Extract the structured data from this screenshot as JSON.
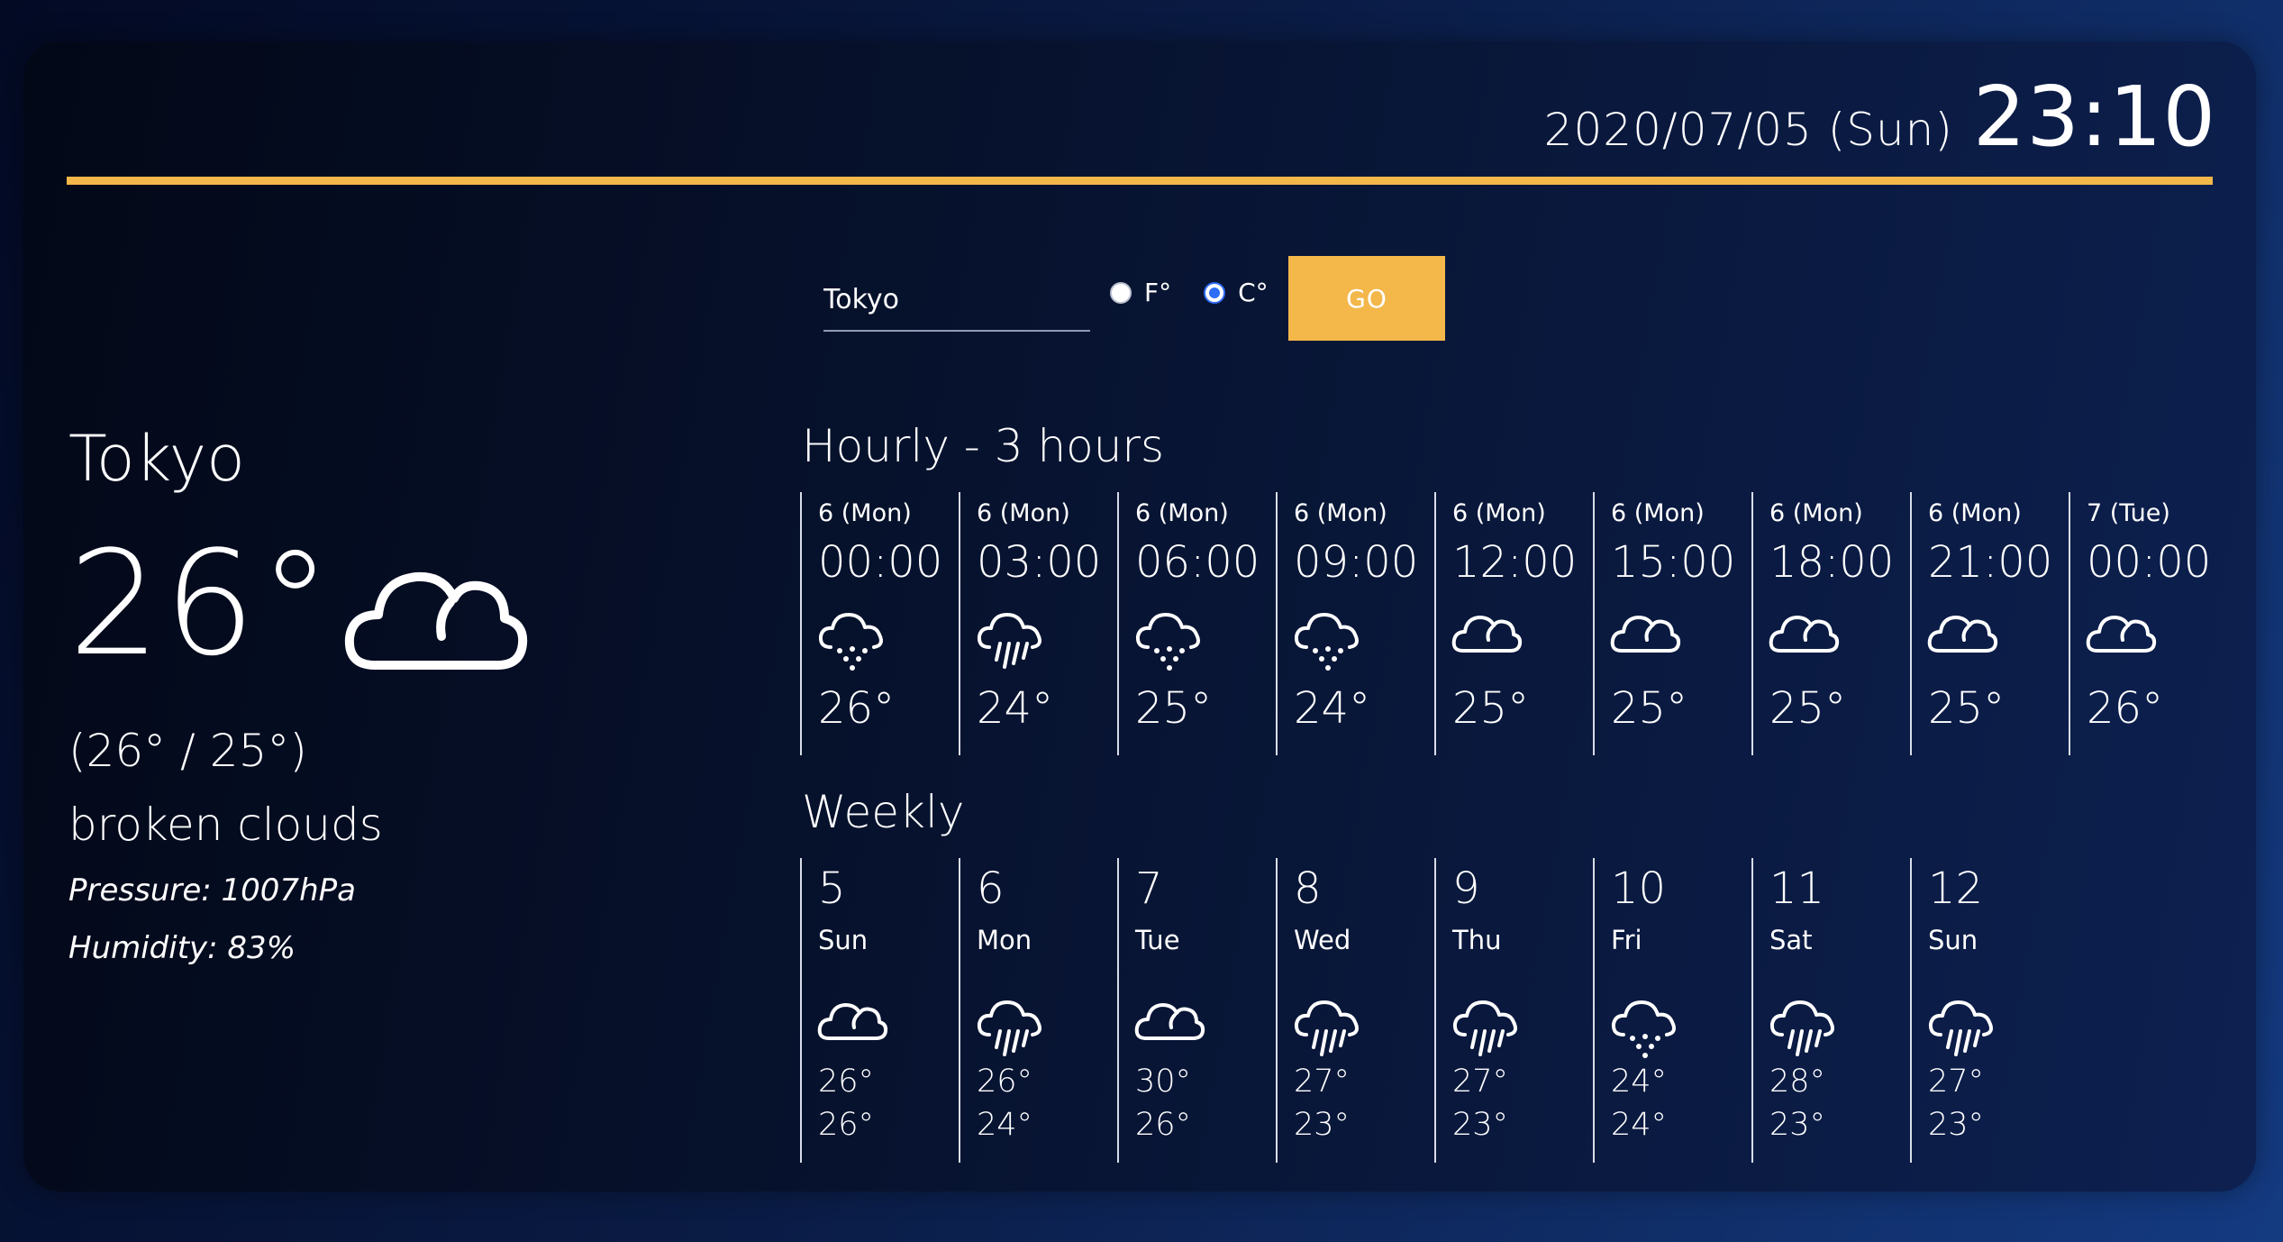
{
  "colors": {
    "accent": "#f3b74a",
    "radio_selected": "#2f6df6"
  },
  "header": {
    "date": "2020/07/05 (Sun)",
    "time": "23:10"
  },
  "search": {
    "city_value": "Tokyo",
    "unit_f_label": "F°",
    "unit_c_label": "C°",
    "selected_unit": "C",
    "go_label": "GO"
  },
  "current": {
    "city": "Tokyo",
    "temp": "26°",
    "icon": "broken-clouds-icon",
    "minmax": "(26° / 25°)",
    "description": "broken clouds",
    "pressure": "Pressure: 1007hPa",
    "humidity": "Humidity: 83%"
  },
  "hourly": {
    "title": "Hourly - 3 hours",
    "items": [
      {
        "day": "6 (Mon)",
        "hour": "00:00",
        "temp": "26°",
        "icon": "drizzle-icon"
      },
      {
        "day": "6 (Mon)",
        "hour": "03:00",
        "temp": "24°",
        "icon": "rain-icon"
      },
      {
        "day": "6 (Mon)",
        "hour": "06:00",
        "temp": "25°",
        "icon": "drizzle-icon"
      },
      {
        "day": "6 (Mon)",
        "hour": "09:00",
        "temp": "24°",
        "icon": "drizzle-icon"
      },
      {
        "day": "6 (Mon)",
        "hour": "12:00",
        "temp": "25°",
        "icon": "cloud-icon"
      },
      {
        "day": "6 (Mon)",
        "hour": "15:00",
        "temp": "25°",
        "icon": "cloud-icon"
      },
      {
        "day": "6 (Mon)",
        "hour": "18:00",
        "temp": "25°",
        "icon": "cloud-icon"
      },
      {
        "day": "6 (Mon)",
        "hour": "21:00",
        "temp": "25°",
        "icon": "cloud-icon"
      },
      {
        "day": "7 (Tue)",
        "hour": "00:00",
        "temp": "26°",
        "icon": "cloud-icon"
      }
    ]
  },
  "weekly": {
    "title": "Weekly",
    "items": [
      {
        "date": "5",
        "dow": "Sun",
        "hi": "26°",
        "lo": "26°",
        "icon": "cloud-icon"
      },
      {
        "date": "6",
        "dow": "Mon",
        "hi": "26°",
        "lo": "24°",
        "icon": "rain-icon"
      },
      {
        "date": "7",
        "dow": "Tue",
        "hi": "30°",
        "lo": "26°",
        "icon": "cloud-icon"
      },
      {
        "date": "8",
        "dow": "Wed",
        "hi": "27°",
        "lo": "23°",
        "icon": "rain-icon"
      },
      {
        "date": "9",
        "dow": "Thu",
        "hi": "27°",
        "lo": "23°",
        "icon": "rain-icon"
      },
      {
        "date": "10",
        "dow": "Fri",
        "hi": "24°",
        "lo": "24°",
        "icon": "drizzle-icon"
      },
      {
        "date": "11",
        "dow": "Sat",
        "hi": "28°",
        "lo": "23°",
        "icon": "rain-icon"
      },
      {
        "date": "12",
        "dow": "Sun",
        "hi": "27°",
        "lo": "23°",
        "icon": "rain-icon"
      }
    ]
  }
}
